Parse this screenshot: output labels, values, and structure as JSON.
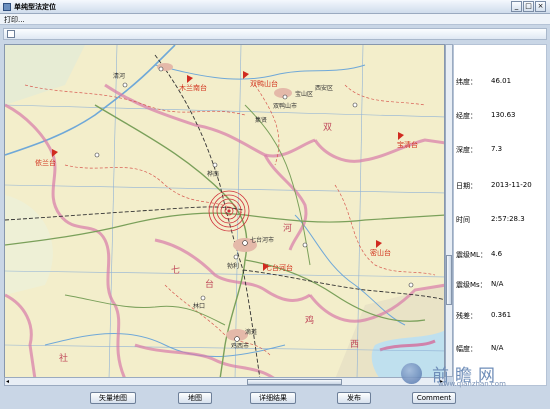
{
  "window": {
    "title": "单纯型法定位",
    "min": "_",
    "max": "□",
    "close": "×"
  },
  "menu": {
    "print_label": "打印..."
  },
  "info": {
    "latitude_label": "纬度：",
    "latitude": "46.01",
    "longitude_label": "经度：",
    "longitude": "130.63",
    "depth_label": "深度：",
    "depth": "7.3",
    "date_label": "日期：",
    "date": "2013-11-20",
    "time_label": "时间",
    "time": "2:57:28.3",
    "ml_label": "震级ML：",
    "ml": "4.6",
    "ms_label": "震级Ms：",
    "ms": "N/A",
    "residual_label": "残差：",
    "residual": "0.361",
    "magnitude_label": "幅度：",
    "magnitude": "N/A"
  },
  "buttons": {
    "vector_map": "矢量地图",
    "map": "地图",
    "details": "详细结果",
    "publish": "发布",
    "comment": "Comment"
  },
  "map": {
    "stations": [
      "木兰南台",
      "双鸭山台",
      "依兰台",
      "宝清台",
      "七台河台",
      "密山台"
    ],
    "cities": [
      "七台河市",
      "勃利",
      "林口",
      "鸡西市",
      "双鸭山市",
      "桦南",
      "宝山区",
      "清河",
      "西安区",
      "滴道",
      "集贤"
    ],
    "regions": [
      "七",
      "台",
      "河",
      "双",
      "鸡",
      "西",
      "社"
    ]
  },
  "watermark": {
    "cn": "前瞻网",
    "url": "www.qianzhan.com"
  }
}
